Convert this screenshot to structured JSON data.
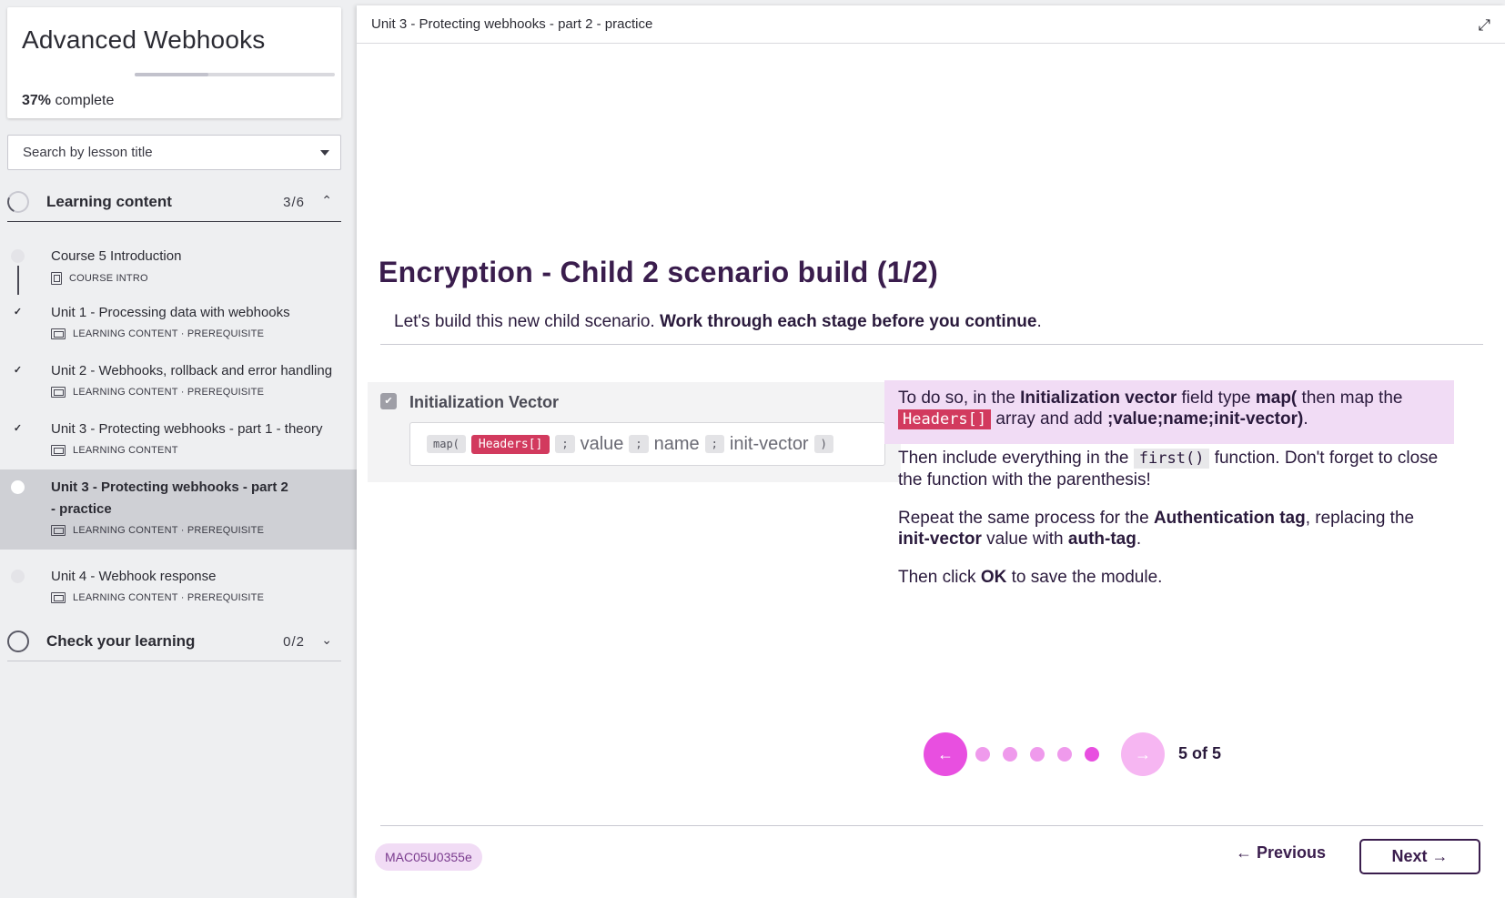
{
  "course": {
    "title": "Advanced Webhooks",
    "progress_percent": 37,
    "progress_pct_label": "37%",
    "progress_suffix": " complete"
  },
  "search": {
    "placeholder": "Search by lesson title"
  },
  "sections": [
    {
      "label": "Learning content",
      "count": "3/6",
      "chevron": "^"
    },
    {
      "label": "Check your learning",
      "count": "0/2",
      "chevron": "v"
    }
  ],
  "lessons": [
    {
      "title": "Course 5 Introduction",
      "meta": "COURSE INTRO",
      "status": "not-started",
      "check": ""
    },
    {
      "title": "Unit 1 - Processing data with webhooks",
      "meta": "LEARNING CONTENT · PREREQUISITE",
      "status": "done",
      "check": "✓"
    },
    {
      "title": "Unit 2 - Webhooks, rollback and error handling",
      "meta": "LEARNING CONTENT · PREREQUISITE",
      "status": "done",
      "check": "✓"
    },
    {
      "title": "Unit 3 - Protecting webhooks - part 1 - theory",
      "meta": "LEARNING CONTENT",
      "status": "done",
      "check": "✓"
    },
    {
      "title": "Unit 3 - Protecting webhooks - part 2 - practice",
      "meta": "LEARNING CONTENT · PREREQUISITE",
      "status": "active",
      "check": ""
    },
    {
      "title": "Unit 4 - Webhook response",
      "meta": "LEARNING CONTENT · PREREQUISITE",
      "status": "not-started",
      "check": ""
    }
  ],
  "topbar": {
    "breadcrumb": "Unit 3 - Protecting webhooks - part 2 - practice",
    "expand_icon": "expand-icon"
  },
  "content": {
    "heading": "Encryption - Child 2 scenario build (1/2)",
    "intro_plain": "Let's build this new child scenario. ",
    "intro_bold": "Work through each stage before you continue",
    "intro_end": "."
  },
  "mock": {
    "label": "Initialization Vector",
    "tokens": [
      "map(",
      "Headers[]",
      ";",
      "value",
      ";",
      "name",
      ";",
      "init-vector",
      ")"
    ]
  },
  "instructions": {
    "p1": [
      "To do so, in the ",
      "Initialization vector",
      " field type ",
      "map(",
      " then map the ",
      "Headers[]",
      " array and add ",
      ";value;name;init-vector)",
      "."
    ],
    "p2": [
      "Then include everything in the ",
      "first()",
      " function. Don't forget to close the function with the parenthesis!"
    ],
    "p3": [
      "Repeat the same process for the ",
      "Authentication tag",
      ", replacing the ",
      "init-vector",
      " value with ",
      "auth-tag",
      "."
    ],
    "p4": [
      "Then click ",
      "OK",
      " to save the module."
    ]
  },
  "carousel": {
    "current": 5,
    "total": 5,
    "label": "5 of 5",
    "prev_glyph": "←",
    "next_glyph": "→"
  },
  "footer": {
    "code": "MAC05U0355e",
    "previous_label": "← Previous",
    "next_label": "Next →"
  },
  "colors": {
    "accent": "#e84fe0",
    "accent_light": "#f6b6f2",
    "highlight": "#f1dcf5",
    "code_red": "#d23a5e",
    "ink": "#3a1d4d"
  }
}
